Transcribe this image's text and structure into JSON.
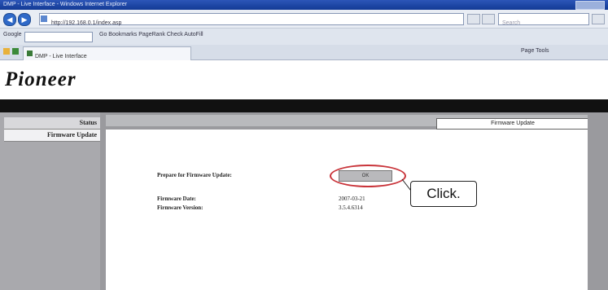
{
  "browser": {
    "title": "DMP - Live Interface - Windows Internet Explorer",
    "address": "http://192.168.0.1/index.asp",
    "search_placeholder": "Search",
    "toolbar_google": "Google",
    "toolbar_links": "Go  Bookmarks  PageRank  Check  AutoFill",
    "tab_title": "DMP - Live Interface",
    "tab_tools": "Page  Tools"
  },
  "page": {
    "logo": "Pioneer",
    "nav": [
      {
        "label": "Status"
      },
      {
        "label": "Firmware Update"
      }
    ],
    "heading": "Firmware Update",
    "prepare_label": "Prepare for Firmware Update:",
    "ok_label": "OK",
    "firmware_date_label": "Firmware Date:",
    "firmware_date_value": "2007-03-21",
    "firmware_version_label": "Firmware Version:",
    "firmware_version_value": "3.5.4.6314",
    "callout": "Click."
  },
  "colors": {
    "highlight": "#c9343a",
    "title_bar": "#2c56b8"
  }
}
